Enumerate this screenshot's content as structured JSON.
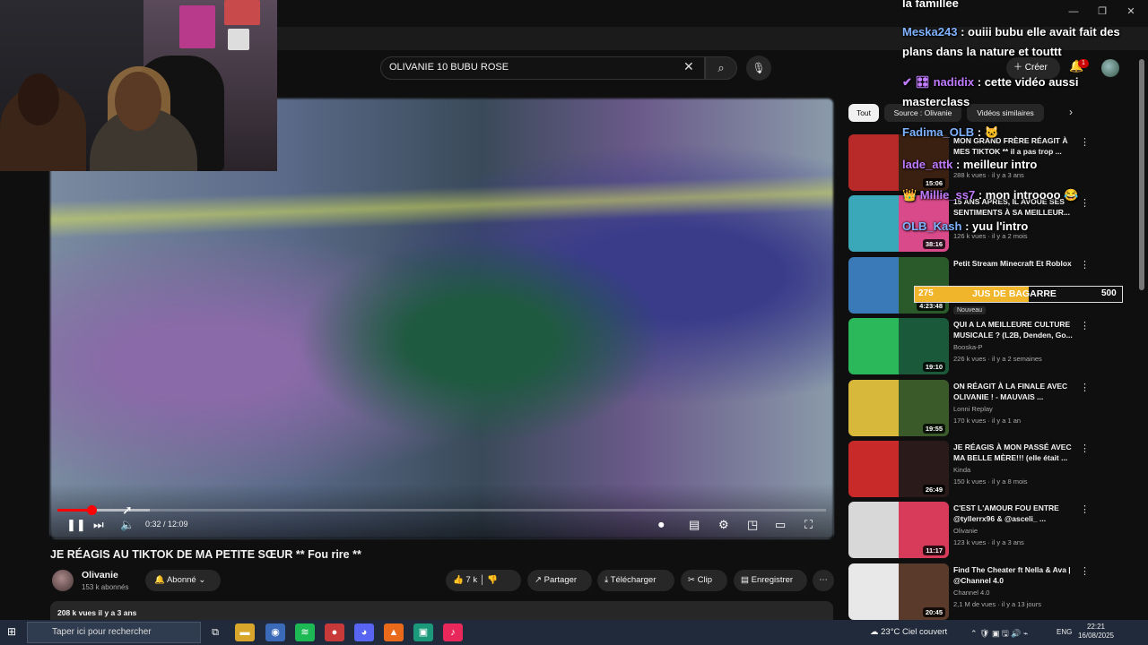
{
  "window": {
    "controls": [
      "—",
      "❐",
      "✕"
    ]
  },
  "search": {
    "query": "OLIVANIE 10 BUBU ROSE",
    "clear_icon": "✕",
    "search_icon": "⌕",
    "mic_icon": "🎙"
  },
  "header": {
    "create_label": "Créer",
    "notif_count": "1"
  },
  "player": {
    "current_time": "0:32",
    "duration": "12:09",
    "time_display": "0:32 / 12:09",
    "progress": 0.044,
    "buffered": 0.12
  },
  "video": {
    "title": "JE RÉAGIS AU TIKTOK DE MA PETITE SŒUR ** Fou rire **",
    "channel": "Olivanie",
    "subscribers": "153 k abonnés",
    "subscribe_label": "Abonné",
    "likes": "7 k",
    "share_label": "Partager",
    "download_label": "Télécharger",
    "clip_label": "Clip",
    "save_label": "Enregistrer",
    "views_date": "208 k vues  il y a 3 ans"
  },
  "chips": [
    "Tout",
    "Source : Olivanie",
    "Vidéos similaires"
  ],
  "recommendations": [
    {
      "title": "MON GRAND FRÈRE RÉAGIT À MES TIKTOK ** il a pas trop ...",
      "channel": "",
      "meta": "288 k vues · il y a 3 ans",
      "duration": "15:06",
      "c1": "#b82a2a",
      "c2": "#3a2010"
    },
    {
      "title": "15 ANS APRÈS, IL AVOUE SES SENTIMENTS À SA MEILLEUR...",
      "channel": "",
      "meta": "126 k vues · il y a 2 mois",
      "duration": "38:16",
      "c1": "#3aa8b8",
      "c2": "#d84a8a"
    },
    {
      "title": "Petit Stream Minecraft Et Roblox",
      "channel": "",
      "meta": "",
      "duration": "4:23:48",
      "c1": "#3a7ab8",
      "c2": "#2a5a2a"
    },
    {
      "title": "QUI A LA MEILLEURE CULTURE MUSICALE ? (L2B, Denden, Go...",
      "channel": "Booska-P",
      "meta": "226 k vues · il y a 2 semaines",
      "duration": "19:10",
      "c1": "#2ab85a",
      "c2": "#1a5a3a"
    },
    {
      "title": "ON RÉAGIT À LA FINALE AVEC OLIVANIE ! - MAUVAIS ...",
      "channel": "Lonni Replay",
      "meta": "170 k vues · il y a 1 an",
      "duration": "19:55",
      "c1": "#d8b83a",
      "c2": "#3a5a2a"
    },
    {
      "title": "JE RÉAGIS À MON PASSÉ AVEC MA BELLE MÈRE!!! (elle était ...",
      "channel": "Kinda",
      "meta": "150 k vues · il y a 8 mois",
      "duration": "26:49",
      "c1": "#c82a2a",
      "c2": "#2a1a1a"
    },
    {
      "title": "C'EST L'AMOUR FOU ENTRE @tyllerrx96 & @asceli_ ...",
      "channel": "Olivanie",
      "meta": "123 k vues · il y a 3 ans",
      "duration": "11:17",
      "c1": "#d8d8d8",
      "c2": "#d83a5a"
    },
    {
      "title": "Find The Cheater ft Nella & Ava | @Channel 4.0",
      "channel": "Channel 4.0",
      "meta": "2,1 M de vues · il y a 13 jours",
      "duration": "20:45",
      "c1": "#e8e8e8",
      "c2": "#5a3a2a"
    }
  ],
  "new_badge": "Nouveau",
  "chat": [
    {
      "user": "",
      "text": "la famillee",
      "color": "#ffffff"
    },
    {
      "user": "Meska243",
      "text": " : ouiii bubu elle avait fait des",
      "color": "#7fb3ff"
    },
    {
      "user": "",
      "text": "plans dans la nature et touttt",
      "color": "#ffffff"
    },
    {
      "user": "✔ 🎛 nadidix",
      "text": " : cette vidéo aussi",
      "color": "#c07bff"
    },
    {
      "user": "",
      "text": "masterclass",
      "color": "#ffffff"
    },
    {
      "user": "Fadima_OLB",
      "text": " : 🐱",
      "color": "#7fb3ff"
    },
    {
      "user": "lade_attk",
      "text": " : meilleur intro",
      "color": "#c07bff"
    },
    {
      "user": "👑 Millie_ss7",
      "text": " : mon introooo 😂",
      "color": "#c07bff"
    },
    {
      "user": "OLB_Kash",
      "text": " : yuu l'intro",
      "color": "#7fb3ff"
    }
  ],
  "goal": {
    "current": "275",
    "label": "JUS DE BAGARRE",
    "max": "500",
    "fraction": 0.55,
    "color": "#f0b52a"
  },
  "taskbar": {
    "search_placeholder": "Taper ici pour rechercher",
    "weather": "23°C  Ciel couvert",
    "lang": "ENG",
    "time": "22:21",
    "date": "16/08/2025"
  }
}
